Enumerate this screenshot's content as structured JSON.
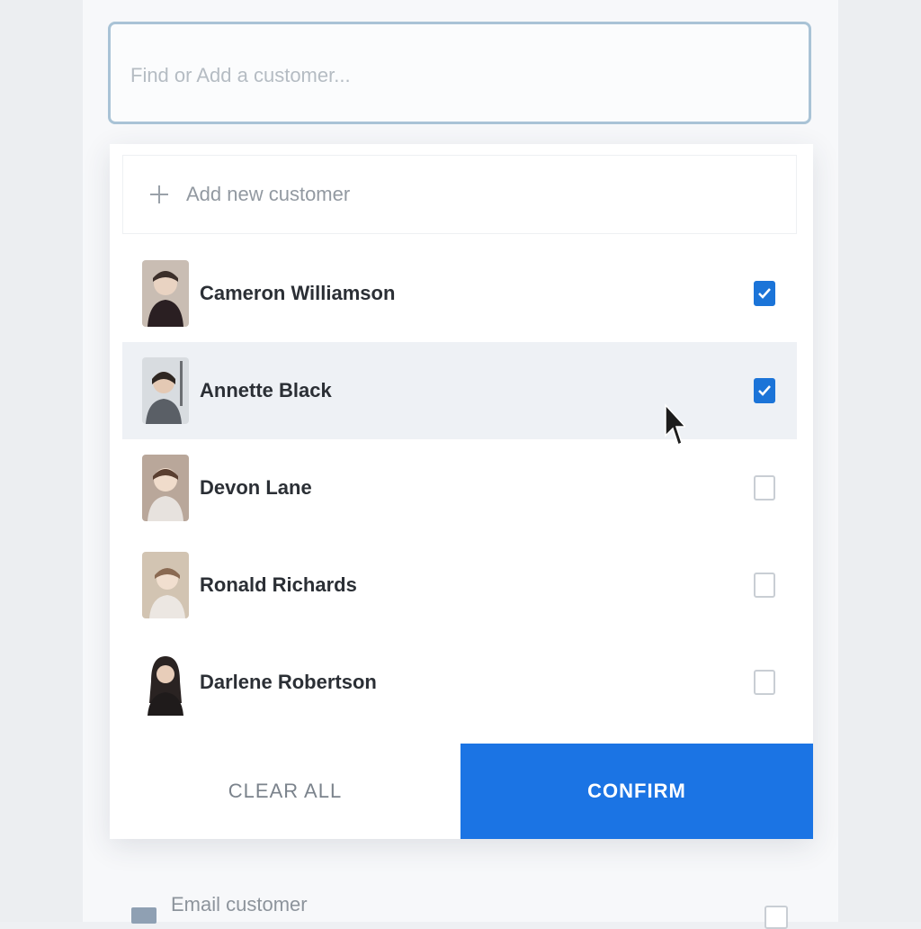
{
  "search": {
    "placeholder": "Find or Add a customer..."
  },
  "dropdown": {
    "add_new_label": "Add new customer",
    "customers": [
      {
        "name": "Cameron Williamson",
        "checked": true,
        "highlighted": false
      },
      {
        "name": "Annette Black",
        "checked": true,
        "highlighted": true
      },
      {
        "name": "Devon Lane",
        "checked": false,
        "highlighted": false
      },
      {
        "name": "Ronald Richards",
        "checked": false,
        "highlighted": false
      },
      {
        "name": "Darlene Robertson",
        "checked": false,
        "highlighted": false
      }
    ],
    "clear_label": "CLEAR ALL",
    "confirm_label": "CONFIRM"
  },
  "email": {
    "label": "Email customer",
    "checked": false
  },
  "colors": {
    "accent": "#1b74e4",
    "checkbox_checked": "#1b74d8",
    "highlight_row": "#eef1f5"
  }
}
